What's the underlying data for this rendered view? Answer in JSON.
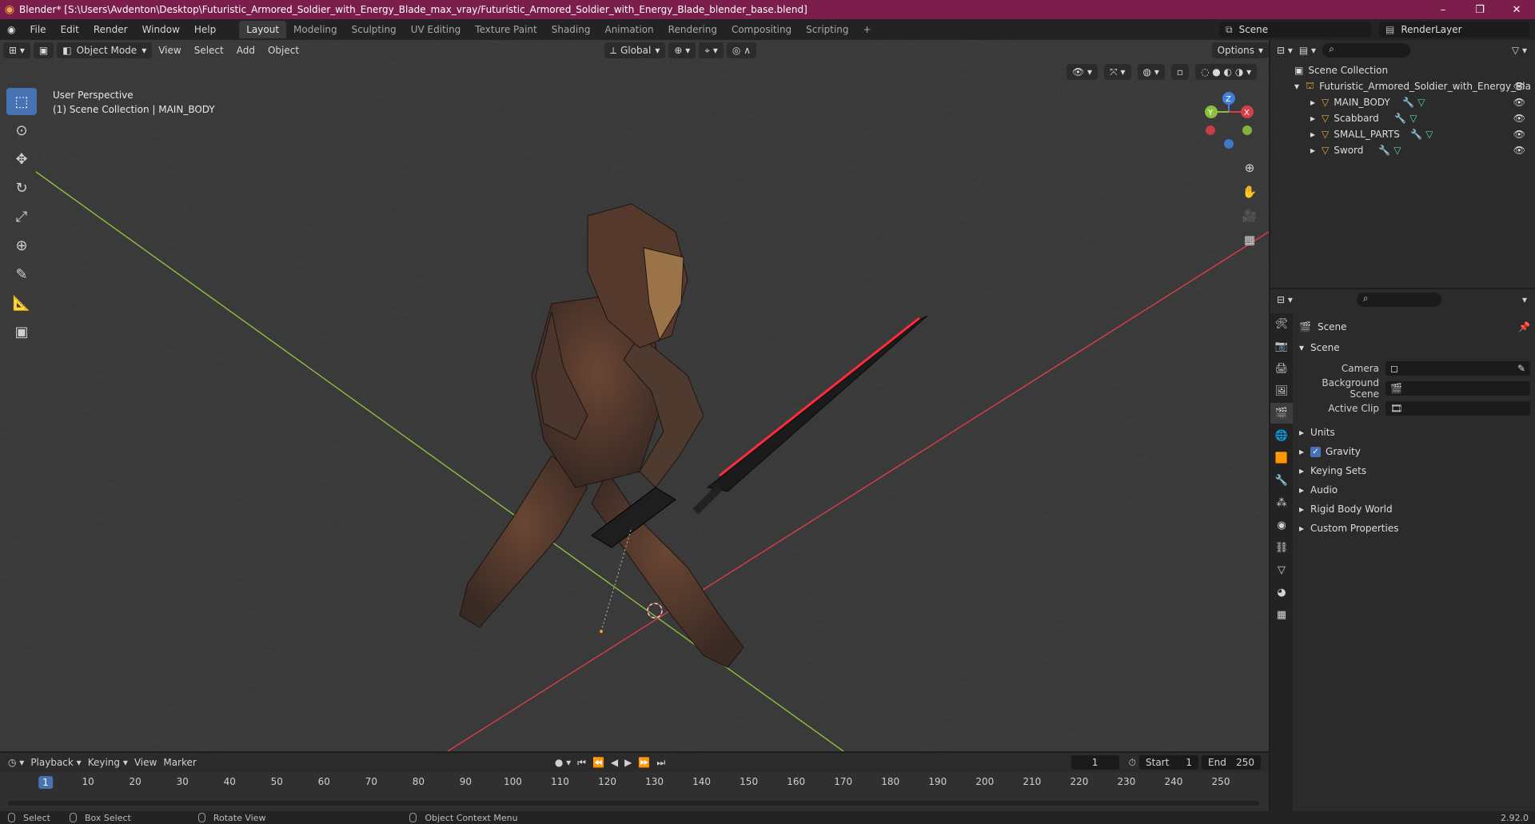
{
  "titlebar": {
    "title": "Blender* [S:\\Users\\Avdenton\\Desktop\\Futuristic_Armored_Soldier_with_Energy_Blade_max_vray/Futuristic_Armored_Soldier_with_Energy_Blade_blender_base.blend]",
    "minimize": "–",
    "maximize": "❐",
    "close": "✕"
  },
  "menu": {
    "items": [
      "File",
      "Edit",
      "Render",
      "Window",
      "Help"
    ]
  },
  "workspaces": [
    "Layout",
    "Modeling",
    "Sculpting",
    "UV Editing",
    "Texture Paint",
    "Shading",
    "Animation",
    "Rendering",
    "Compositing",
    "Scripting"
  ],
  "workspace_add": "+",
  "scene_selector": {
    "scene": "Scene",
    "view_layer": "RenderLayer"
  },
  "viewport": {
    "mode": "Object Mode",
    "menus": [
      "View",
      "Select",
      "Add",
      "Object"
    ],
    "transform_orientation": "Global",
    "options_label": "Options",
    "info_line1": "User Perspective",
    "info_line2": "(1) Scene Collection | MAIN_BODY",
    "gizmo": {
      "x": "X",
      "y": "Y",
      "z": "Z"
    }
  },
  "outliner": {
    "root": "Scene Collection",
    "collection": "Futuristic_Armored_Soldier_with_Energy_Bla",
    "objects": [
      "MAIN_BODY",
      "Scabbard",
      "SMALL_PARTS",
      "Sword"
    ]
  },
  "properties": {
    "header": "Scene",
    "panel": "Scene",
    "fields": {
      "camera_label": "Camera",
      "background_scene_label": "Background Scene",
      "active_clip_label": "Active Clip"
    },
    "collapsed_panels": [
      "Units",
      "Gravity",
      "Keying Sets",
      "Audio",
      "Rigid Body World",
      "Custom Properties"
    ],
    "gravity_checked": true
  },
  "timeline": {
    "menus": [
      "Playback",
      "Keying",
      "View",
      "Marker"
    ],
    "current_frame": "1",
    "start_label": "Start",
    "start_value": "1",
    "end_label": "End",
    "end_value": "250",
    "ruler": [
      "1",
      "10",
      "20",
      "30",
      "40",
      "50",
      "60",
      "70",
      "80",
      "90",
      "100",
      "110",
      "120",
      "130",
      "140",
      "150",
      "160",
      "170",
      "180",
      "190",
      "200",
      "210",
      "220",
      "230",
      "240",
      "250"
    ]
  },
  "statusbar": {
    "select": "Select",
    "box_select": "Box Select",
    "rotate_view": "Rotate View",
    "context_menu": "Object Context Menu",
    "version": "2.92.0"
  },
  "colors": {
    "titlebar": "#7b1e4c",
    "accent_blue": "#4772b3",
    "x_axis": "#d63e4a",
    "y_axis": "#8cbf3f",
    "z_axis": "#3f7fd6",
    "blade_glow": "#ff2a3a"
  }
}
